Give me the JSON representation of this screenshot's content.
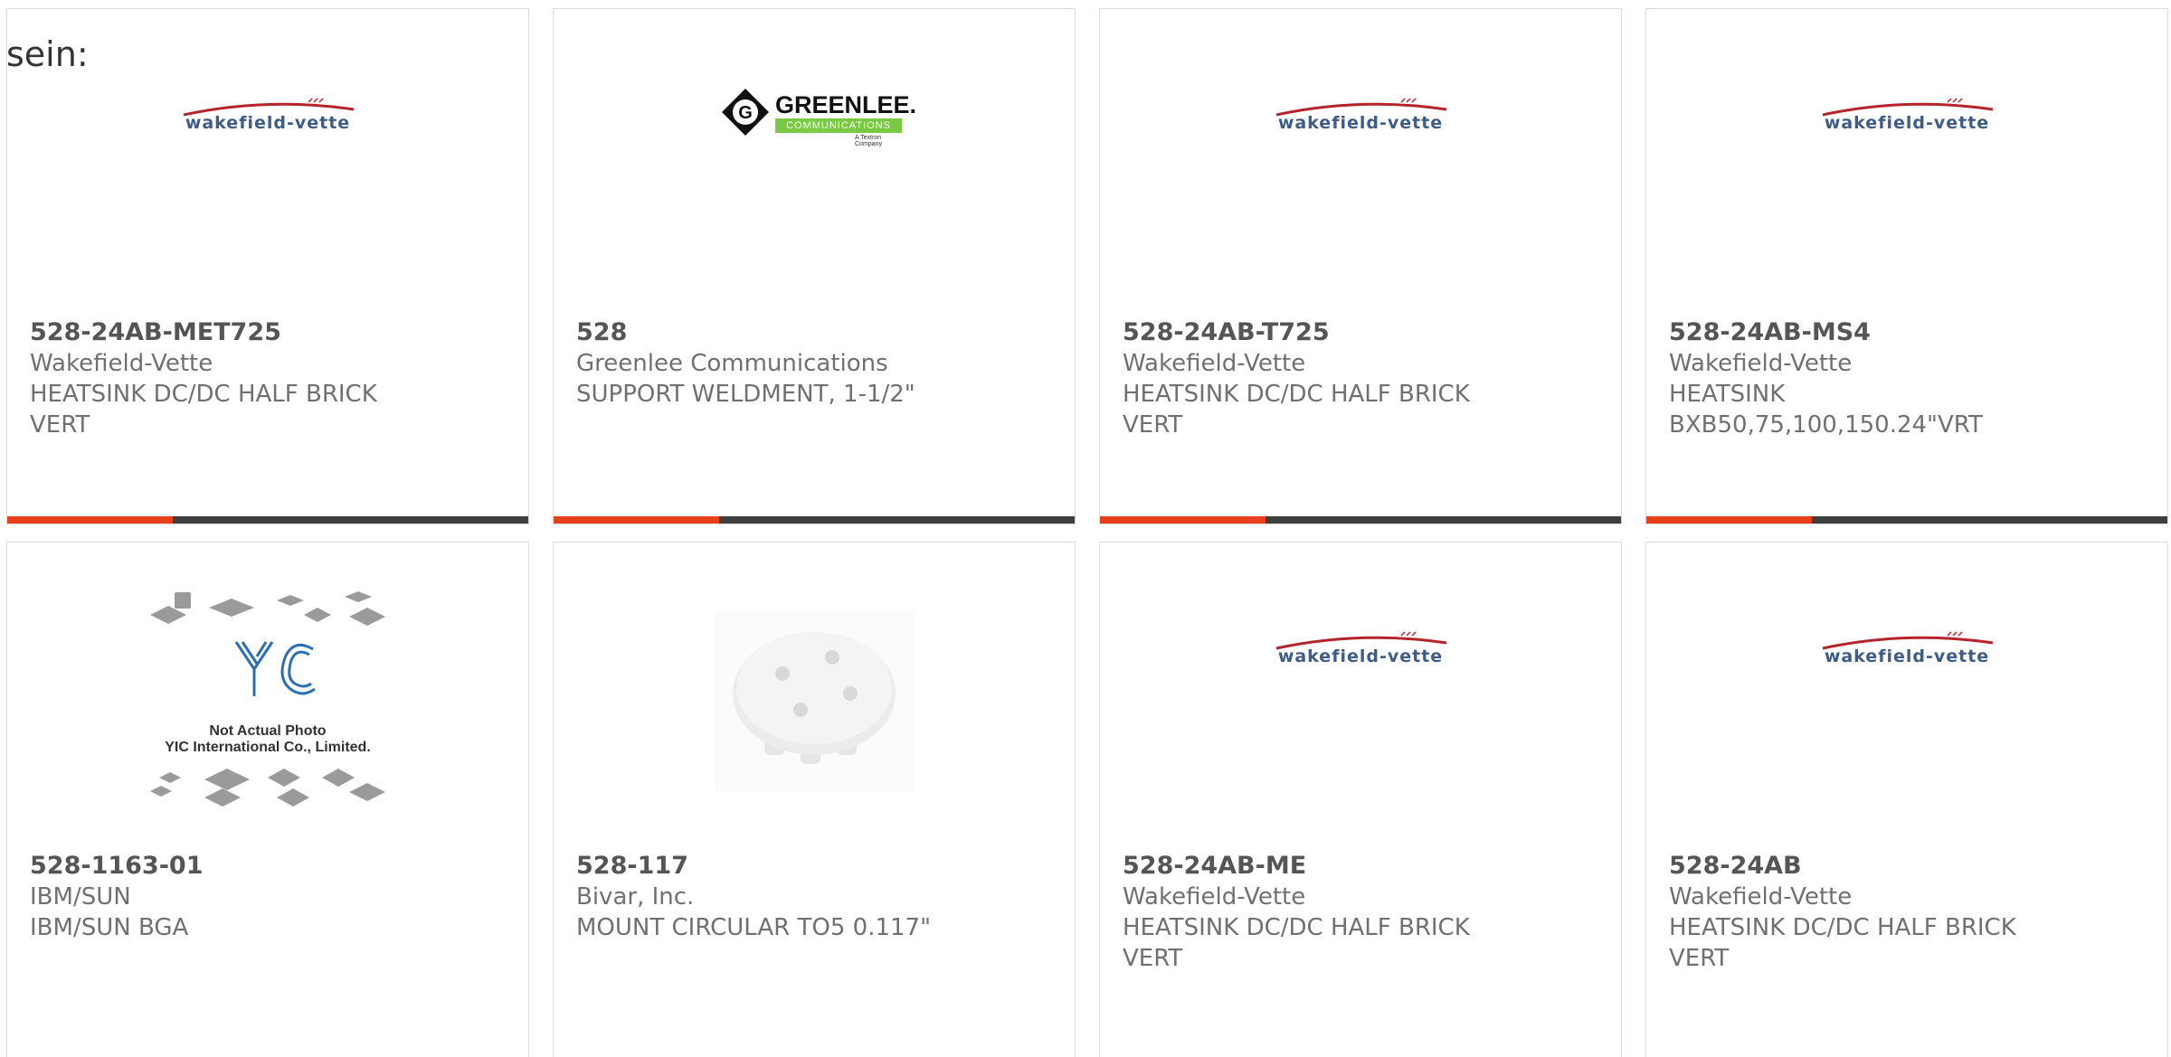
{
  "intro_text": "sein:",
  "colors": {
    "accent": "#e8401c",
    "bar": "#3f3f3f",
    "part_number": "#555555",
    "text": "#707070"
  },
  "products": [
    {
      "part_number": "528-24AB-MET725",
      "manufacturer": "Wakefield-Vette",
      "description": "HEATSINK DC/DC HALF BRICK VERT",
      "image": "wakefield-vette-logo"
    },
    {
      "part_number": "528",
      "manufacturer": "Greenlee Communications",
      "description": "SUPPORT WELDMENT, 1-1/2\"",
      "image": "greenlee-logo"
    },
    {
      "part_number": "528-24AB-T725",
      "manufacturer": "Wakefield-Vette",
      "description": "HEATSINK DC/DC HALF BRICK VERT",
      "image": "wakefield-vette-logo"
    },
    {
      "part_number": "528-24AB-MS4",
      "manufacturer": "Wakefield-Vette",
      "description": "HEATSINK BXB50,75,100,150.24\"VRT",
      "image": "wakefield-vette-logo"
    },
    {
      "part_number": "528-1163-01",
      "manufacturer": "IBM/SUN",
      "description": "IBM/SUN BGA",
      "image": "yic-placeholder"
    },
    {
      "part_number": "528-117",
      "manufacturer": "Bivar, Inc.",
      "description": "MOUNT CIRCULAR TO5 0.117\"",
      "image": "mount-photo"
    },
    {
      "part_number": "528-24AB-ME",
      "manufacturer": "Wakefield-Vette",
      "description": "HEATSINK DC/DC HALF BRICK VERT",
      "image": "wakefield-vette-logo"
    },
    {
      "part_number": "528-24AB",
      "manufacturer": "Wakefield-Vette",
      "description": "HEATSINK DC/DC HALF BRICK VERT",
      "image": "wakefield-vette-logo"
    }
  ],
  "logos": {
    "wakefield": "wakefield-vette",
    "greenlee_word": "GREENLEE.",
    "greenlee_sub": "COMMUNICATIONS",
    "greenlee_tag": "A Textron Company",
    "yic_line1": "Not Actual Photo",
    "yic_line2": "YIC International Co., Limited."
  }
}
